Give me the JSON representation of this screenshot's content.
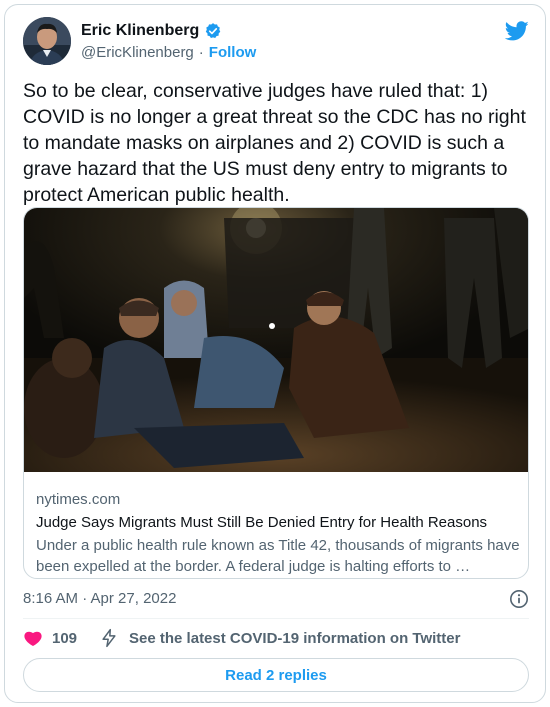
{
  "author": {
    "name": "Eric Klinenberg",
    "handle": "@EricKlinenberg",
    "separator": "·",
    "follow_label": "Follow"
  },
  "tweet": {
    "text": "So to be clear, conservative judges have ruled that: 1) COVID is no longer a great threat so the CDC has no right to mandate masks on airplanes and 2) COVID is such a grave hazard that the US must deny entry to migrants to protect American public health."
  },
  "link_card": {
    "domain": "nytimes.com",
    "title": "Judge Says Migrants Must Still Be Denied Entry for Health Reasons",
    "description": "Under a public health rule known as Title 42, thousands of migrants have been expelled at the border. A federal judge is halting efforts to …"
  },
  "timestamp": "8:16 AM · Apr 27, 2022",
  "actions": {
    "like_count": "109",
    "covid_info_label": "See the latest COVID-19 information on Twitter"
  },
  "replies_button_label": "Read 2 replies",
  "icons": {
    "verified": "verified-badge-icon",
    "twitter": "twitter-bird-icon",
    "info": "info-icon",
    "heart": "heart-icon",
    "bolt": "lightning-bolt-icon"
  },
  "colors": {
    "accent": "#1d9bf0",
    "like": "#f91880",
    "text": "#0f1419",
    "secondary": "#536471"
  }
}
